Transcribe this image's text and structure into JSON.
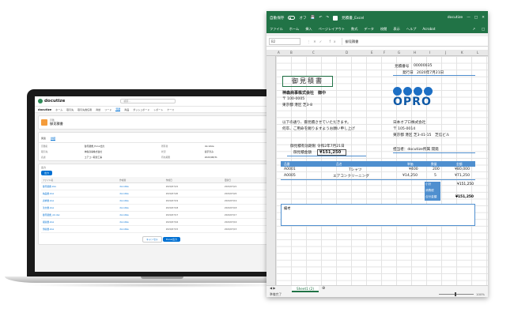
{
  "laptop": {
    "app_logo": "docutize",
    "search_placeholder": "検索...",
    "nav": [
      "docutize",
      "ホーム",
      "取引先",
      "取引先責任者",
      "商談",
      "リード",
      "見積",
      "商品",
      "ダッシュボード",
      "レポート",
      "ケース"
    ],
    "record_type": "見積",
    "record_title": "御見積書",
    "tabs": [
      "関連",
      "詳細"
    ],
    "active_tab": "詳細",
    "detail": [
      {
        "k": "見積名",
        "v": "御見積書_Excel出力",
        "k2": "所有者",
        "v2": "docutize"
      },
      {
        "k": "取引先",
        "v": "神森商事株式会社",
        "k2": "状況",
        "v2": "提示済み"
      },
      {
        "k": "商談",
        "v": "エアコン取替工事",
        "k2": "有効期限",
        "v2": "2020/08/31"
      }
    ],
    "output_label": "出力",
    "output_button": "出力",
    "table_headers": [
      "ファイル名",
      "作成者",
      "作成日",
      "更新日"
    ],
    "table_rows": [
      [
        "御見積書.xlsx",
        "docutize",
        "2020/07/21",
        "2020/07/21"
      ],
      [
        "納品書.xlsx",
        "docutize",
        "2020/07/20",
        "2020/07/20"
      ],
      [
        "請求書.xlsx",
        "docutize",
        "2020/07/19",
        "2020/07/19"
      ],
      [
        "注文書.xlsx",
        "docutize",
        "2020/07/18",
        "2020/07/18"
      ],
      [
        "御見積書_v2.xlsx",
        "docutize",
        "2020/07/17",
        "2020/07/17"
      ],
      [
        "検収書.xlsx",
        "docutize",
        "2020/07/16",
        "2020/07/16"
      ],
      [
        "領収書.xlsx",
        "docutize",
        "2020/07/15",
        "2020/07/15"
      ]
    ],
    "cancel_button": "キャンセル",
    "submit_button": "Excel出力"
  },
  "excel": {
    "autosave_label": "自動保存",
    "autosave_state": "オフ",
    "filename": "見積書_Excel",
    "user": "docutize",
    "menu": [
      "ファイル",
      "ホーム",
      "挿入",
      "ページレイアウト",
      "数式",
      "データ",
      "校閲",
      "表示",
      "ヘルプ",
      "Acrobat"
    ],
    "name_box": "B2",
    "formula": "御見積書",
    "columns": [
      "A",
      "B",
      "C",
      "D",
      "E",
      "F",
      "G",
      "H",
      "I",
      "J",
      "K",
      "L"
    ],
    "doc": {
      "title": "御見積書",
      "estimate_no_label": "見積番号",
      "estimate_no": "00000035",
      "issue_date_label": "発行日",
      "issue_date": "2020年7月21日",
      "customer": "神森商事株式会社　御中",
      "customer_zip": "〒 100-0005",
      "customer_addr": "東京都 港区 芝3-8",
      "intro_1": "以下の通り、御見積させていただきます。",
      "intro_2": "何卒、ご用命を賜りますようお願い申し上げ",
      "issuer_name": "日本オプロ株式会社",
      "issuer_zip": "〒 105-0014",
      "issuer_addr": "東京都 港区 芝3-41-15　芝信ビル",
      "valid_label": "御見積有効期限",
      "valid_value": "令和2年7月21日",
      "amount_label": "御見積金額",
      "amount_value": "¥151,250",
      "rep": "担当者：docutize所属 開発",
      "logo_text": "OPRO",
      "headers": [
        "品番",
        "品名",
        "単価",
        "数量",
        "金額"
      ],
      "items": [
        {
          "code": "A0001",
          "name": "Tシャツ",
          "price": "¥400",
          "qty": "200",
          "amount": "¥80,000"
        },
        {
          "code": "A0005",
          "name": "エアコンクリーニング",
          "price": "¥14,250",
          "qty": "5",
          "amount": "¥71,250"
        }
      ],
      "subtotal_label": "小計",
      "subtotal": "¥151,250",
      "tax_label": "消費税",
      "tax": "",
      "total_label": "合計金額",
      "total": "¥151,250",
      "remarks_label": "備考"
    },
    "sheet_tab": "Sheet1 (2)",
    "status": "準備完了",
    "zoom": "100%"
  }
}
